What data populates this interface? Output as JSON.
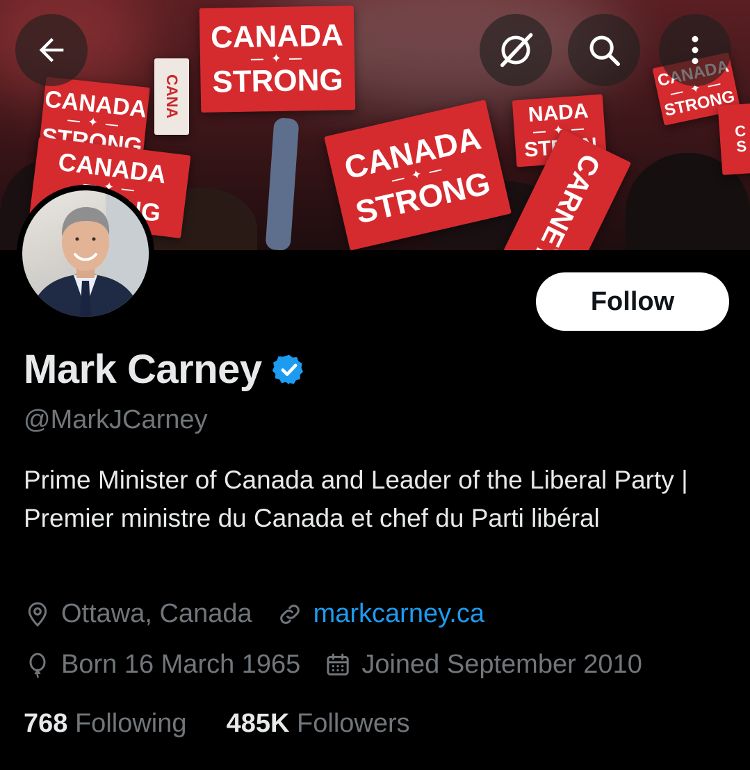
{
  "banner": {
    "signs": [
      {
        "line1": "CANADA",
        "line2": "STRONG"
      },
      {
        "line1": "CANADA",
        "line2": "STRONG"
      },
      {
        "line1": "CANADA",
        "line2": "STRONG"
      },
      {
        "line1": "CANADA",
        "line2": "STRONG"
      },
      {
        "line1": "NADA",
        "line2": "STRON"
      },
      {
        "line1": "CANADA",
        "line2": "STRONG"
      }
    ],
    "side_sign_text": "CARNEY",
    "vertical_sign_text": "CANA"
  },
  "toolbar": {
    "back_icon": "arrow-left-icon",
    "translate_icon": "grok-icon",
    "search_icon": "search-icon",
    "more_icon": "more-vertical-icon"
  },
  "profile": {
    "follow_label": "Follow",
    "name": "Mark Carney",
    "handle": "@MarkJCarney",
    "bio": "Prime Minister of Canada and Leader of the Liberal Party | Premier ministre du Canada et chef du Parti libéral",
    "location": "Ottawa, Canada",
    "website": "markcarney.ca",
    "born": "Born 16 March 1965",
    "joined": "Joined September 2010",
    "following_count": "768",
    "following_label": "Following",
    "followers_count": "485K",
    "followers_label": "Followers"
  },
  "colors": {
    "accent": "#1d9bf0",
    "muted": "#71767b",
    "text": "#e7e9ea",
    "background": "#000000",
    "sign_red": "#d52b2f"
  }
}
